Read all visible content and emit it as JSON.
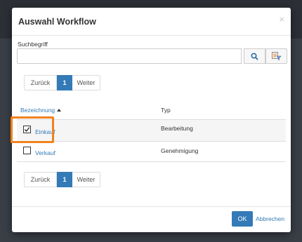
{
  "dialog": {
    "title": "Auswahl Workflow",
    "close_glyph": "×"
  },
  "search": {
    "label": "Suchbegriff",
    "value": "",
    "placeholder": "",
    "search_icon": "search-icon",
    "filter_icon": "filter-icon"
  },
  "pager_top": {
    "prev": "Zurück",
    "page": "1",
    "next": "Weiter"
  },
  "pager_bottom": {
    "prev": "Zurück",
    "page": "1",
    "next": "Weiter"
  },
  "table": {
    "columns": [
      "Bezeichnung",
      "Typ"
    ],
    "sorted_column": "Bezeichnung",
    "sort_direction": "ascending",
    "rows": [
      {
        "name": "Einkauf",
        "type": "Bearbeitung",
        "checked": true
      },
      {
        "name": "Verkauf",
        "type": "Genehmigung",
        "checked": false
      }
    ]
  },
  "footer": {
    "ok_label": "OK",
    "cancel_label": "Abbrechen"
  },
  "colors": {
    "accent": "#337ab7",
    "highlight": "#f0821e"
  }
}
